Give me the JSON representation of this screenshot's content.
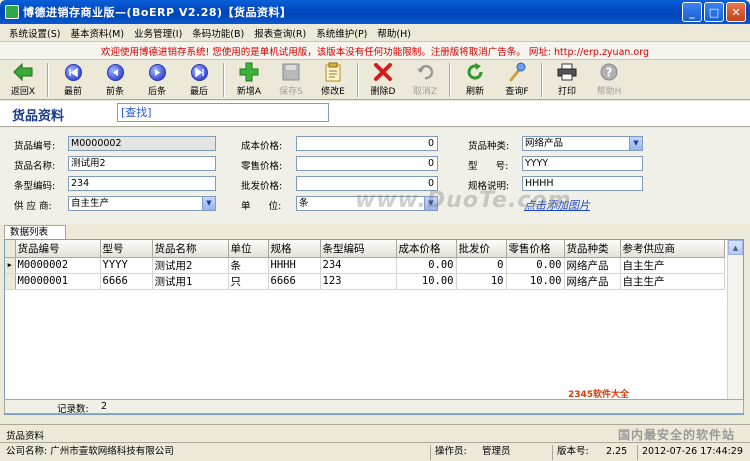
{
  "window": {
    "title": "博德进销存商业版—(BoERP V2.28)【货品资料】",
    "buttons": {
      "minimize": "_",
      "maximize": "□",
      "close": "✕"
    }
  },
  "menu": [
    {
      "label": "系统设置(S)"
    },
    {
      "label": "基本资料(M)"
    },
    {
      "label": "业务管理(I)"
    },
    {
      "label": "条码功能(B)"
    },
    {
      "label": "报表查询(R)"
    },
    {
      "label": "系统维护(P)"
    },
    {
      "label": "帮助(H)"
    }
  ],
  "notice": "欢迎使用博德进销存系统! 您使用的是单机试用版，该版本没有任何功能限制。注册版将取消广告条。 网址: http://erp.zyuan.org",
  "toolbar": [
    {
      "name": "back",
      "label": "返回X",
      "icon": "back-arrow-icon",
      "enabled": true
    },
    {
      "name": "first",
      "label": "最前",
      "icon": "first-icon",
      "enabled": true
    },
    {
      "name": "prev",
      "label": "前条",
      "icon": "prev-icon",
      "enabled": true
    },
    {
      "name": "next",
      "label": "后条",
      "icon": "next-icon",
      "enabled": true
    },
    {
      "name": "last",
      "label": "最后",
      "icon": "last-icon",
      "enabled": true
    },
    {
      "name": "add",
      "label": "新增A",
      "icon": "plus-icon",
      "enabled": true
    },
    {
      "name": "save",
      "label": "保存S",
      "icon": "save-icon",
      "enabled": false
    },
    {
      "name": "edit",
      "label": "修改E",
      "icon": "edit-icon",
      "enabled": true
    },
    {
      "name": "delete",
      "label": "删除D",
      "icon": "delete-icon",
      "enabled": true
    },
    {
      "name": "cancel",
      "label": "取消Z",
      "icon": "undo-icon",
      "enabled": false
    },
    {
      "name": "refresh",
      "label": "刷新",
      "icon": "refresh-icon",
      "enabled": true
    },
    {
      "name": "search",
      "label": "查询F",
      "icon": "search-icon",
      "enabled": true
    },
    {
      "name": "print",
      "label": "打印",
      "icon": "printer-icon",
      "enabled": true
    },
    {
      "name": "help",
      "label": "帮助H",
      "icon": "help-icon",
      "enabled": false
    }
  ],
  "header": {
    "title": "货品资料",
    "find_placeholder": "[查找]"
  },
  "form": {
    "code": {
      "label": "货品编号:",
      "value": "M0000002"
    },
    "name": {
      "label": "货品名称:",
      "value": "测试用2"
    },
    "barcode": {
      "label": "条型编码:",
      "value": "234"
    },
    "supplier": {
      "label": "供 应 商:",
      "value": "自主生产"
    },
    "cost": {
      "label": "成本价格:",
      "value": "0"
    },
    "retail": {
      "label": "零售价格:",
      "value": "0"
    },
    "wholesale": {
      "label": "批发价格:",
      "value": "0"
    },
    "unit": {
      "label": "单      位:",
      "value": "条"
    },
    "category": {
      "label": "货品种类:",
      "value": "网络产品"
    },
    "model": {
      "label": "型      号:",
      "value": "YYYY"
    },
    "spec": {
      "label": "规格说明:",
      "value": "HHHH"
    },
    "add_image_link": "点击添加图片"
  },
  "grid": {
    "tab_label": "数据列表",
    "columns": [
      "货品编号",
      "型号",
      "货品名称",
      "单位",
      "规格",
      "条型编码",
      "成本价格",
      "批发价",
      "零售价格",
      "货品种类",
      "参考供应商"
    ],
    "rows": [
      {
        "current": true,
        "cells": [
          "M0000002",
          "YYYY",
          "测试用2",
          "条",
          "HHHH",
          "234",
          "0.00",
          "0",
          "0.00",
          "网络产品",
          "自主生产"
        ]
      },
      {
        "current": false,
        "cells": [
          "M0000001",
          "6666",
          "测试用1",
          "只",
          "6666",
          "123",
          "10.00",
          "10",
          "10.00",
          "网络产品",
          "自主生产"
        ]
      }
    ],
    "record_count_label": "记录数:",
    "record_count": "2"
  },
  "bottom_tab": "货品资料",
  "status": {
    "company": "公司名称: 广州市壹软网络科技有限公司",
    "operator_label": "操作员:",
    "operator": "管理员",
    "version_label": "版本号:",
    "version": "2.25",
    "datetime": "2012-07-26 17:44:29"
  },
  "watermarks": {
    "duote": "www.DuoTe.com",
    "site": "2345软件大全",
    "slogan": "国内最安全的软件站"
  },
  "colors": {
    "titlebar": "#0a5fd8",
    "notice_text": "#d40000",
    "link": "#1b47c8",
    "page_title": "#1a3a8a"
  }
}
